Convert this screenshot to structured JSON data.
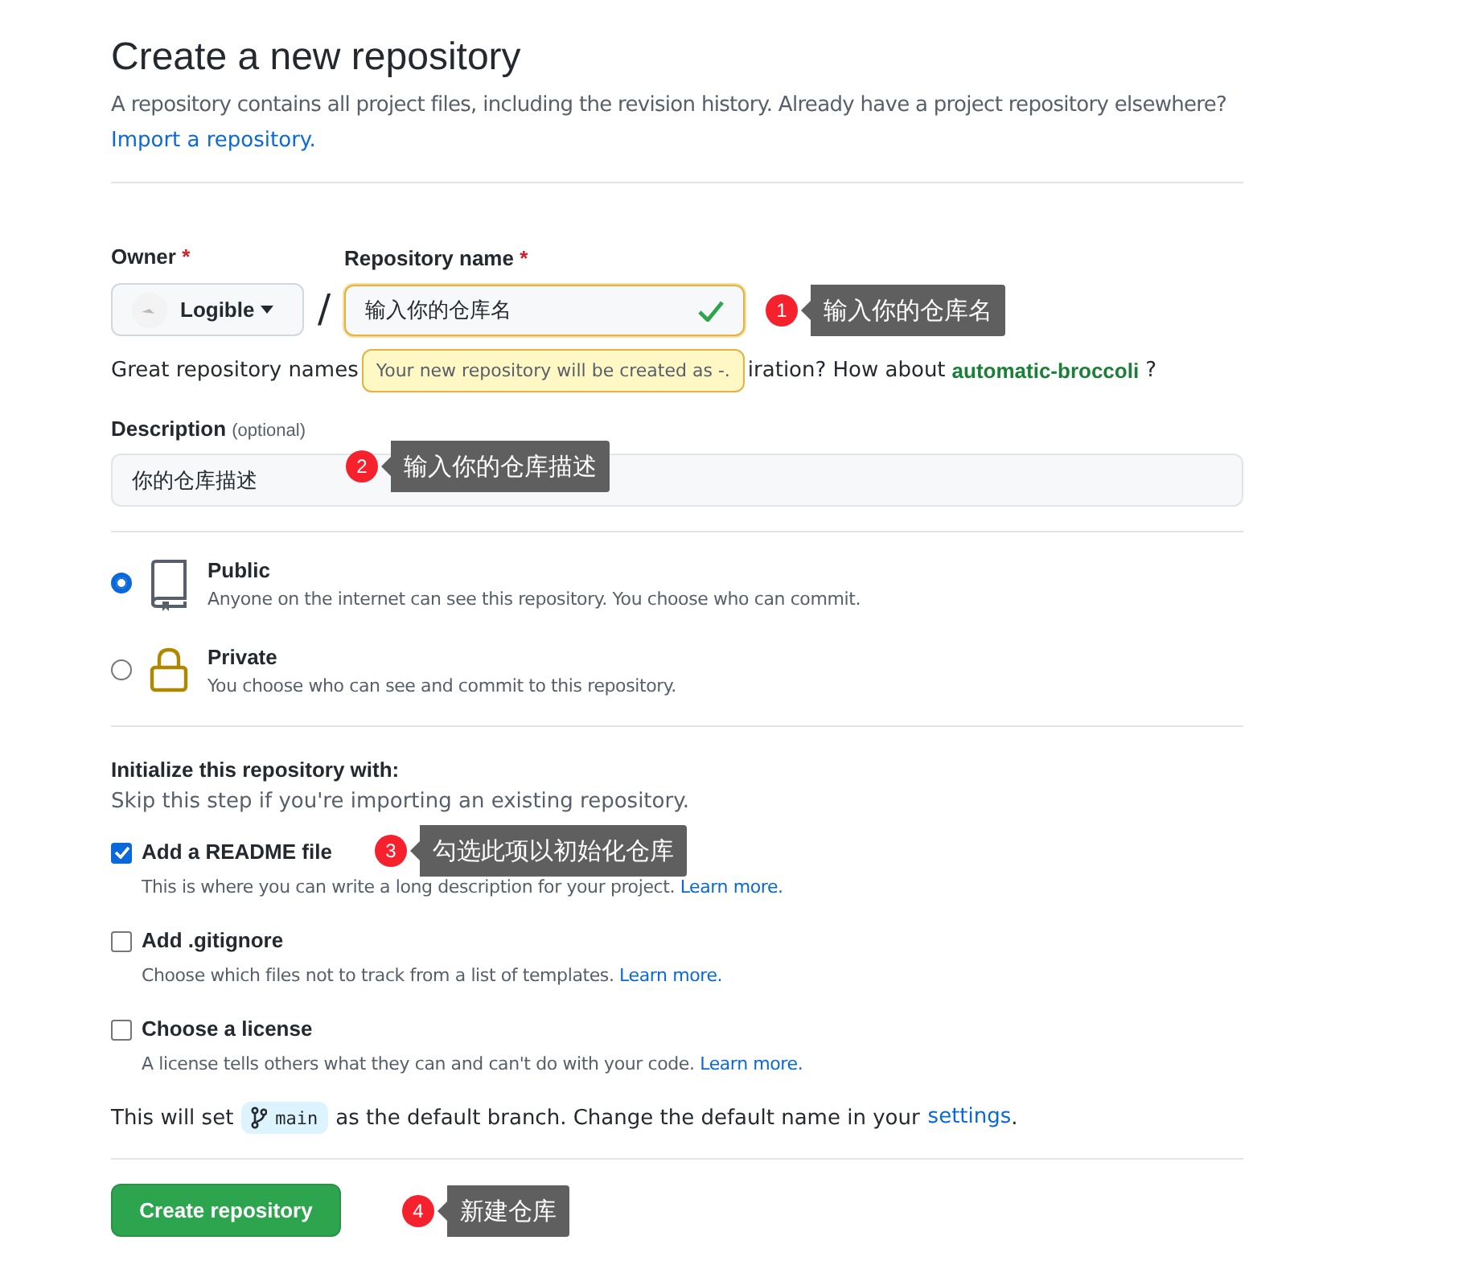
{
  "heading": {
    "title": "Create a new repository",
    "subtitle": "A repository contains all project files, including the revision history. Already have a project repository elsewhere?",
    "import_link": "Import a repository."
  },
  "owner": {
    "label": "Owner",
    "required_mark": "*",
    "value": "Logible"
  },
  "separator": "/",
  "repo_name": {
    "label": "Repository name",
    "required_mark": "*",
    "value": "输入你的仓库名",
    "valid": true,
    "annotation": {
      "number": "1",
      "text": "输入你的仓库名"
    }
  },
  "name_hint": {
    "before": "Great repository names",
    "tooltip": "Your new repository will be created as -.",
    "after": "iration? How about",
    "suggestion": "automatic-broccoli",
    "end": "?"
  },
  "description": {
    "label": "Description",
    "optional": "(optional)",
    "value": "你的仓库描述",
    "annotation": {
      "number": "2",
      "text": "输入你的仓库描述"
    }
  },
  "visibility": [
    {
      "kind": "book",
      "label": "Public",
      "note": "Anyone on the internet can see this repository. You choose who can commit.",
      "selected": true
    },
    {
      "kind": "lock",
      "label": "Private",
      "note": "You choose who can see and commit to this repository.",
      "selected": false
    }
  ],
  "init": {
    "title": "Initialize this repository with:",
    "note": "Skip this step if you're importing an existing repository.",
    "options": [
      {
        "label": "Add a README file",
        "note": "This is where you can write a long description for your project.",
        "link": "Learn more.",
        "checked": true,
        "annotation": {
          "number": "3",
          "text": "勾选此项以初始化仓库"
        }
      },
      {
        "label": "Add .gitignore",
        "note": "Choose which files not to track from a list of templates.",
        "link": "Learn more.",
        "checked": false
      },
      {
        "label": "Choose a license",
        "note": "A license tells others what they can and can't do with your code.",
        "link": "Learn more.",
        "checked": false
      }
    ]
  },
  "branch_note": {
    "before": "This will set",
    "branch": "main",
    "after": "as the default branch. Change the default name in your",
    "link": "settings",
    "end": "."
  },
  "create_button": {
    "label": "Create repository",
    "annotation": {
      "number": "4",
      "text": "新建仓库"
    }
  }
}
